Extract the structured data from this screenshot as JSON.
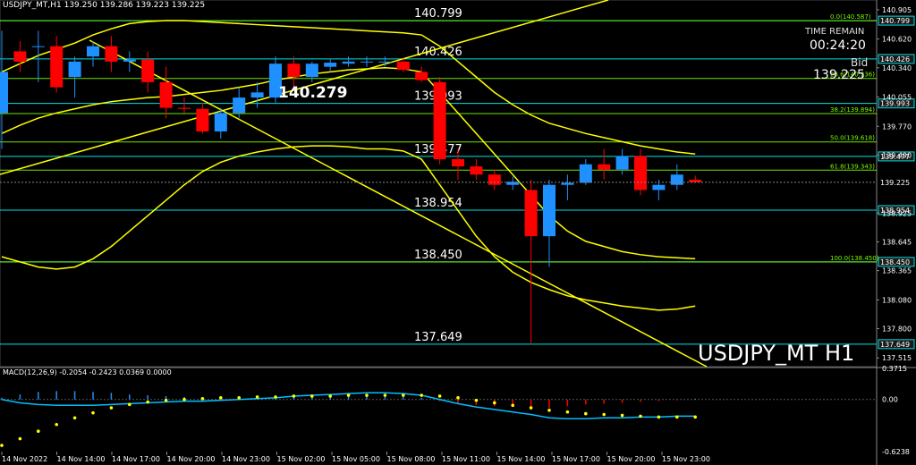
{
  "header": {
    "symbol": "USDJPY_MT,H1",
    "ohlc": "139.250 139.286 139.223 139.225"
  },
  "info": {
    "time_remain_label": "TIME REMAIN",
    "time_remain_value": "00:24:20",
    "bid_label": "Bid",
    "bid_value": "139.225",
    "big_level_label": "140.279",
    "symbol_big": "USDJPY_MT H1"
  },
  "macd_header": "MACD(12,26,9) -0.2054 -0.2423 0.0369 0.0000",
  "colors": {
    "background": "#000000",
    "bull": "#1e90ff",
    "bear": "#ff0000",
    "level_line": "#00e0e0",
    "fib_line": "#7cfc00",
    "band": "#ffff00",
    "macd_hist": "#1e90ff",
    "macd_signal": "#ffff00",
    "macd_line": "#00bfff"
  },
  "chart_data": {
    "type": "candlestick",
    "title": "USDJPY_MT,H1",
    "ylim": [
      137.43,
      141.0
    ],
    "x_ticks": [
      "14 Nov 2022",
      "14 Nov 14:00",
      "14 Nov 17:00",
      "14 Nov 20:00",
      "14 Nov 23:00",
      "15 Nov 02:00",
      "15 Nov 05:00",
      "15 Nov 08:00",
      "15 Nov 11:00",
      "15 Nov 14:00",
      "15 Nov 17:00",
      "15 Nov 20:00",
      "15 Nov 23:00"
    ],
    "y_ticks": [
      "140.905",
      "140.620",
      "140.340",
      "140.055",
      "139.770",
      "139.490",
      "138.925",
      "138.645",
      "138.365",
      "138.080",
      "137.800",
      "137.515"
    ],
    "candles": [
      {
        "o": 139.9,
        "h": 140.7,
        "l": 139.55,
        "c": 140.3
      },
      {
        "o": 140.5,
        "h": 140.6,
        "l": 140.3,
        "c": 140.4
      },
      {
        "o": 140.55,
        "h": 140.7,
        "l": 140.2,
        "c": 140.55
      },
      {
        "o": 140.55,
        "h": 140.65,
        "l": 140.1,
        "c": 140.15
      },
      {
        "o": 140.25,
        "h": 140.45,
        "l": 140.05,
        "c": 140.4
      },
      {
        "o": 140.45,
        "h": 140.6,
        "l": 140.35,
        "c": 140.55
      },
      {
        "o": 140.55,
        "h": 140.65,
        "l": 140.3,
        "c": 140.4
      },
      {
        "o": 140.4,
        "h": 140.5,
        "l": 140.3,
        "c": 140.42
      },
      {
        "o": 140.42,
        "h": 140.5,
        "l": 140.1,
        "c": 140.2
      },
      {
        "o": 140.2,
        "h": 140.35,
        "l": 139.85,
        "c": 139.95
      },
      {
        "o": 139.95,
        "h": 140.05,
        "l": 139.9,
        "c": 139.94
      },
      {
        "o": 139.94,
        "h": 140.0,
        "l": 139.7,
        "c": 139.72
      },
      {
        "o": 139.72,
        "h": 139.95,
        "l": 139.65,
        "c": 139.9
      },
      {
        "o": 139.9,
        "h": 140.15,
        "l": 139.85,
        "c": 140.05
      },
      {
        "o": 140.05,
        "h": 140.2,
        "l": 139.95,
        "c": 140.1
      },
      {
        "o": 140.05,
        "h": 140.45,
        "l": 140.0,
        "c": 140.38
      },
      {
        "o": 140.38,
        "h": 140.45,
        "l": 140.15,
        "c": 140.25
      },
      {
        "o": 140.25,
        "h": 140.4,
        "l": 140.2,
        "c": 140.38
      },
      {
        "o": 140.35,
        "h": 140.42,
        "l": 140.3,
        "c": 140.39
      },
      {
        "o": 140.38,
        "h": 140.45,
        "l": 140.35,
        "c": 140.4
      },
      {
        "o": 140.4,
        "h": 140.45,
        "l": 140.35,
        "c": 140.4
      },
      {
        "o": 140.4,
        "h": 140.45,
        "l": 140.35,
        "c": 140.4
      },
      {
        "o": 140.4,
        "h": 140.43,
        "l": 140.3,
        "c": 140.32
      },
      {
        "o": 140.3,
        "h": 140.35,
        "l": 140.2,
        "c": 140.22
      },
      {
        "o": 140.2,
        "h": 140.25,
        "l": 139.4,
        "c": 139.45
      },
      {
        "o": 139.45,
        "h": 139.55,
        "l": 139.25,
        "c": 139.38
      },
      {
        "o": 139.38,
        "h": 139.45,
        "l": 139.25,
        "c": 139.3
      },
      {
        "o": 139.3,
        "h": 139.35,
        "l": 139.15,
        "c": 139.2
      },
      {
        "o": 139.2,
        "h": 139.28,
        "l": 139.15,
        "c": 139.23
      },
      {
        "o": 139.15,
        "h": 139.25,
        "l": 137.65,
        "c": 138.7
      },
      {
        "o": 138.7,
        "h": 139.25,
        "l": 138.4,
        "c": 139.2
      },
      {
        "o": 139.2,
        "h": 139.3,
        "l": 139.05,
        "c": 139.22
      },
      {
        "o": 139.22,
        "h": 139.45,
        "l": 139.2,
        "c": 139.4
      },
      {
        "o": 139.4,
        "h": 139.55,
        "l": 139.25,
        "c": 139.35
      },
      {
        "o": 139.35,
        "h": 139.55,
        "l": 139.3,
        "c": 139.48
      },
      {
        "o": 139.48,
        "h": 139.55,
        "l": 139.1,
        "c": 139.15
      },
      {
        "o": 139.15,
        "h": 139.25,
        "l": 139.05,
        "c": 139.2
      },
      {
        "o": 139.2,
        "h": 139.4,
        "l": 139.15,
        "c": 139.3
      },
      {
        "o": 139.25,
        "h": 139.29,
        "l": 139.22,
        "c": 139.225
      }
    ],
    "levels": [
      {
        "value": 140.799,
        "label": "140.799",
        "axis_label": "140.799"
      },
      {
        "value": 140.426,
        "label": "140.426",
        "axis_label": "140.426"
      },
      {
        "value": 139.993,
        "label": "139.993",
        "axis_label": "139.993"
      },
      {
        "value": 139.477,
        "label": "139.477",
        "axis_label": "139.477"
      },
      {
        "value": 138.954,
        "label": "138.954",
        "axis_label": "138.954"
      },
      {
        "value": 138.45,
        "label": "138.450",
        "axis_label": "138.450"
      },
      {
        "value": 137.649,
        "label": "137.649",
        "axis_label": "137.649"
      }
    ],
    "fib_levels": [
      {
        "value": 140.799,
        "label": "0.0(140.587)"
      },
      {
        "value": 140.236,
        "label": "23.6(140.236)"
      },
      {
        "value": 139.894,
        "label": "38.2(139.894)"
      },
      {
        "value": 139.618,
        "label": "50.0(139.618)"
      },
      {
        "value": 139.343,
        "label": "61.8(139.343)"
      },
      {
        "value": 138.45,
        "label": "100.0(138.450)"
      }
    ],
    "current_price": {
      "value": 139.225,
      "label": "139.225"
    },
    "bands": {
      "upper": [
        140.3,
        140.38,
        140.46,
        140.52,
        140.58,
        140.66,
        140.72,
        140.77,
        140.79,
        140.8,
        140.8,
        140.79,
        140.78,
        140.77,
        140.76,
        140.75,
        140.74,
        140.73,
        140.72,
        140.71,
        140.7,
        140.69,
        140.68,
        140.66,
        140.55,
        140.4,
        140.25,
        140.1,
        139.98,
        139.88,
        139.8,
        139.75,
        139.7,
        139.66,
        139.62,
        139.58,
        139.55,
        139.52,
        139.5
      ],
      "middle": [
        139.7,
        139.78,
        139.85,
        139.9,
        139.94,
        139.98,
        140.01,
        140.03,
        140.05,
        140.06,
        140.08,
        140.1,
        140.12,
        140.15,
        140.18,
        140.22,
        140.25,
        140.28,
        140.3,
        140.32,
        140.33,
        140.34,
        140.33,
        140.3,
        140.1,
        139.9,
        139.7,
        139.5,
        139.3,
        139.1,
        138.9,
        138.75,
        138.65,
        138.6,
        138.55,
        138.52,
        138.5,
        138.49,
        138.48
      ],
      "lower": [
        138.5,
        138.45,
        138.4,
        138.38,
        138.4,
        138.48,
        138.6,
        138.75,
        138.9,
        139.05,
        139.2,
        139.33,
        139.42,
        139.48,
        139.52,
        139.55,
        139.57,
        139.58,
        139.58,
        139.57,
        139.55,
        139.55,
        139.53,
        139.45,
        139.2,
        138.95,
        138.7,
        138.5,
        138.35,
        138.25,
        138.18,
        138.12,
        138.08,
        138.05,
        138.02,
        138.0,
        137.98,
        137.99,
        138.02
      ]
    },
    "macd": {
      "ylim": [
        -0.6238,
        0.3715
      ],
      "y_ticks": [
        "0.3715",
        "0.00",
        "-0.6238"
      ],
      "histogram": [
        0.02,
        0.06,
        0.09,
        0.1,
        0.1,
        0.09,
        0.08,
        0.06,
        0.05,
        0.04,
        0.03,
        0.02,
        0.02,
        0.02,
        0.02,
        0.03,
        0.03,
        0.03,
        0.04,
        0.04,
        0.04,
        0.03,
        0.03,
        0.02,
        -0.02,
        -0.05,
        -0.07,
        -0.08,
        -0.09,
        -0.1,
        -0.1,
        -0.08,
        -0.06,
        -0.05,
        -0.04,
        -0.03,
        -0.02,
        -0.01,
        0.01
      ],
      "signal": [
        -0.55,
        -0.47,
        -0.38,
        -0.3,
        -0.22,
        -0.16,
        -0.1,
        -0.06,
        -0.03,
        -0.01,
        0.0,
        0.01,
        0.02,
        0.02,
        0.03,
        0.03,
        0.04,
        0.04,
        0.04,
        0.05,
        0.05,
        0.05,
        0.05,
        0.05,
        0.04,
        0.02,
        -0.01,
        -0.04,
        -0.07,
        -0.1,
        -0.13,
        -0.15,
        -0.17,
        -0.18,
        -0.19,
        -0.2,
        -0.21,
        -0.21,
        -0.21
      ],
      "macd_line": [
        0.0,
        -0.04,
        -0.06,
        -0.07,
        -0.07,
        -0.07,
        -0.06,
        -0.05,
        -0.04,
        -0.03,
        -0.02,
        -0.02,
        -0.01,
        0.0,
        0.01,
        0.02,
        0.04,
        0.05,
        0.06,
        0.07,
        0.08,
        0.08,
        0.07,
        0.05,
        0.0,
        -0.05,
        -0.09,
        -0.12,
        -0.15,
        -0.18,
        -0.22,
        -0.23,
        -0.23,
        -0.22,
        -0.22,
        -0.21,
        -0.21,
        -0.2,
        -0.2
      ]
    }
  }
}
